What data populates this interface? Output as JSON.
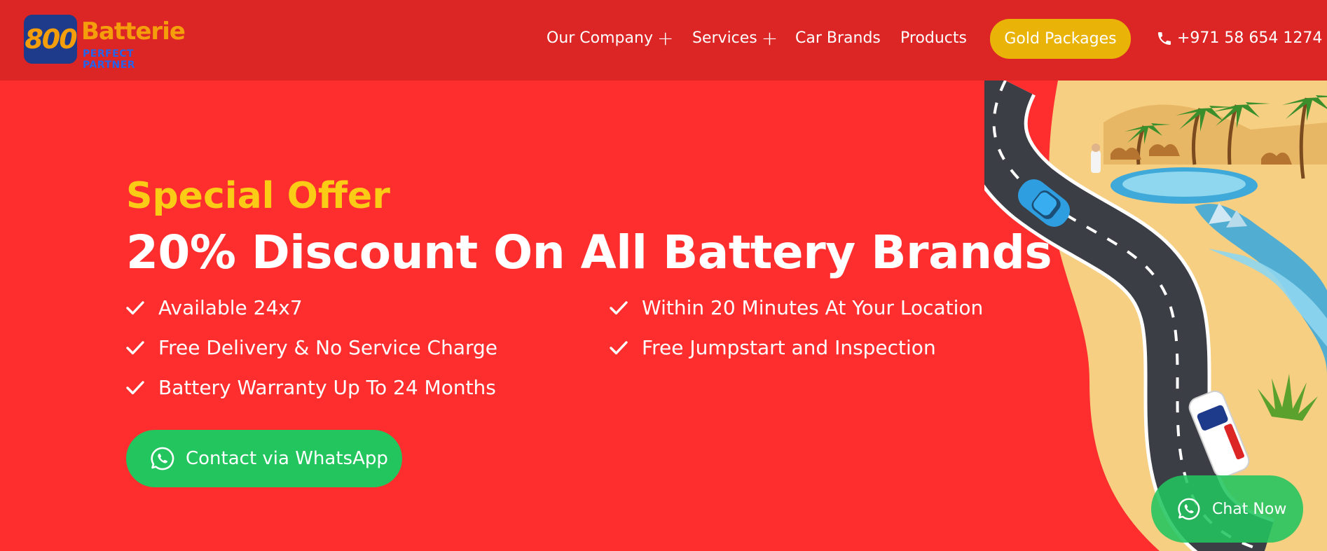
{
  "header": {
    "logo": {
      "badge_text": "800",
      "word": "Batterie",
      "tagline": "PERFECT PARTNER"
    },
    "nav": [
      {
        "label": "Our Company",
        "has_submenu": true
      },
      {
        "label": "Services",
        "has_submenu": true
      },
      {
        "label": "Car Brands",
        "has_submenu": false
      },
      {
        "label": "Products",
        "has_submenu": false
      }
    ],
    "cta_label": "Gold Packages",
    "phone": "+971 58 654 1274",
    "submenu_glyph": "+"
  },
  "hero": {
    "eyebrow": "Special Offer",
    "headline": "20% Discount On All Battery Brands",
    "features_left": [
      "Available 24x7",
      "Free Delivery & No Service Charge",
      "Battery Warranty Up To 24 Months"
    ],
    "features_right": [
      "Within 20 Minutes At Your Location",
      "Free Jumpstart and Inspection"
    ],
    "whatsapp_label": "Contact via WhatsApp"
  },
  "chat": {
    "label": "Chat Now"
  },
  "colors": {
    "header_bg": "#dc2626",
    "hero_bg": "#ff2e2e",
    "accent_yellow": "#facc15",
    "gold_button": "#eab308",
    "whatsapp_green": "#22c55e"
  },
  "icons": {
    "phone": "phone-icon",
    "check": "check-icon",
    "whatsapp": "whatsapp-icon",
    "submenu": "plus-icon"
  }
}
